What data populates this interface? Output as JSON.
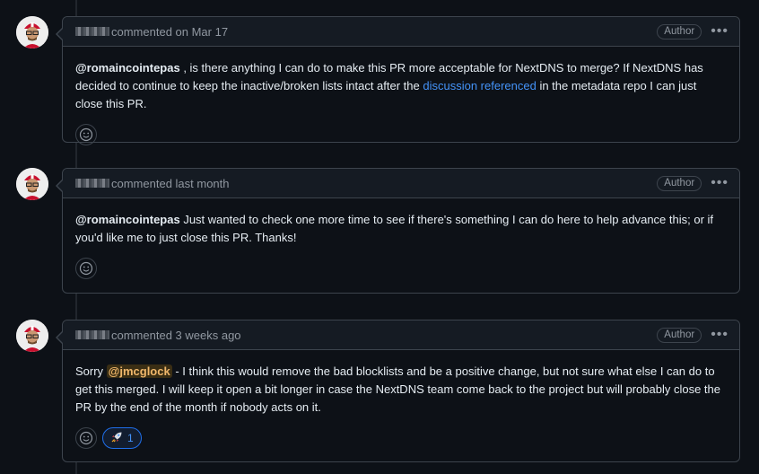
{
  "comments": [
    {
      "meta": "commented on Mar 17",
      "badge": "Author",
      "body": {
        "mention": "@romaincointepas",
        "text1": " , is there anything I can do to make this PR more acceptable for NextDNS to merge? If NextDNS has decided to continue to keep the inactive/broken lists intact after the ",
        "link": "discussion referenced",
        "text2": " in the metadata repo I can just close this PR."
      }
    },
    {
      "meta": "commented last month",
      "badge": "Author",
      "body": {
        "mention": "@romaincointepas",
        "text1": " Just wanted to check one more time to see if there's something I can do here to help advance this; or if you'd like me to just close this PR. Thanks!"
      }
    },
    {
      "meta": "commented 3 weeks ago",
      "badge": "Author",
      "body": {
        "prefix": "Sorry ",
        "mention": "@jmcglock",
        "text1": " - I think this would remove the bad blocklists and be a positive change, but not sure what else I can do to get this merged. I will keep it open a bit longer in case the NextDNS team come back to the project but will probably close the PR by the end of the month if nobody acts on it."
      },
      "reaction": {
        "icon": "rocket-icon",
        "count": "1"
      }
    }
  ],
  "icons": {
    "more": "kebab-horizontal-icon",
    "add_reaction": "smiley-icon"
  },
  "colors": {
    "link": "#4493f8",
    "background": "#0d1117",
    "border": "#3d444d"
  }
}
